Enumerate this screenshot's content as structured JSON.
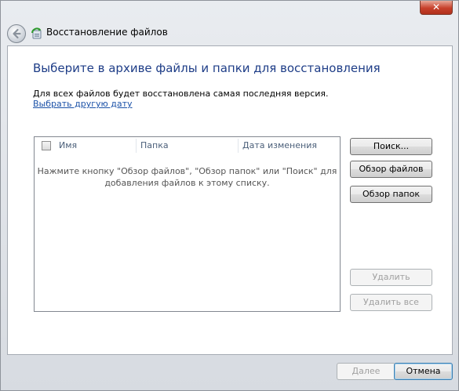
{
  "titlebar": {
    "close_label": "✕"
  },
  "nav": {
    "title": "Восстановление файлов",
    "icon": "restore-files-icon"
  },
  "main": {
    "heading": "Выберите в архиве файлы и папки для восстановления",
    "info_text": "Для всех файлов будет восстановлена самая последняя версия.",
    "date_link": "Выбрать другую дату"
  },
  "file_list": {
    "columns": [
      "Имя",
      "Папка",
      "Дата изменения"
    ],
    "empty_message_line1": "Нажмите кнопку \"Обзор файлов\", \"Обзор папок\" или \"Поиск\" для",
    "empty_message_line2": "добавления файлов к этому списку."
  },
  "side_buttons": {
    "search": "Поиск...",
    "browse_files": "Обзор файлов",
    "browse_folders": "Обзор папок",
    "remove": "Удалить",
    "remove_all": "Удалить все"
  },
  "footer": {
    "next": "Далее",
    "cancel": "Отмена"
  },
  "colors": {
    "heading": "#1e3d87",
    "link": "#1c52a8",
    "close": "#c7402b"
  }
}
